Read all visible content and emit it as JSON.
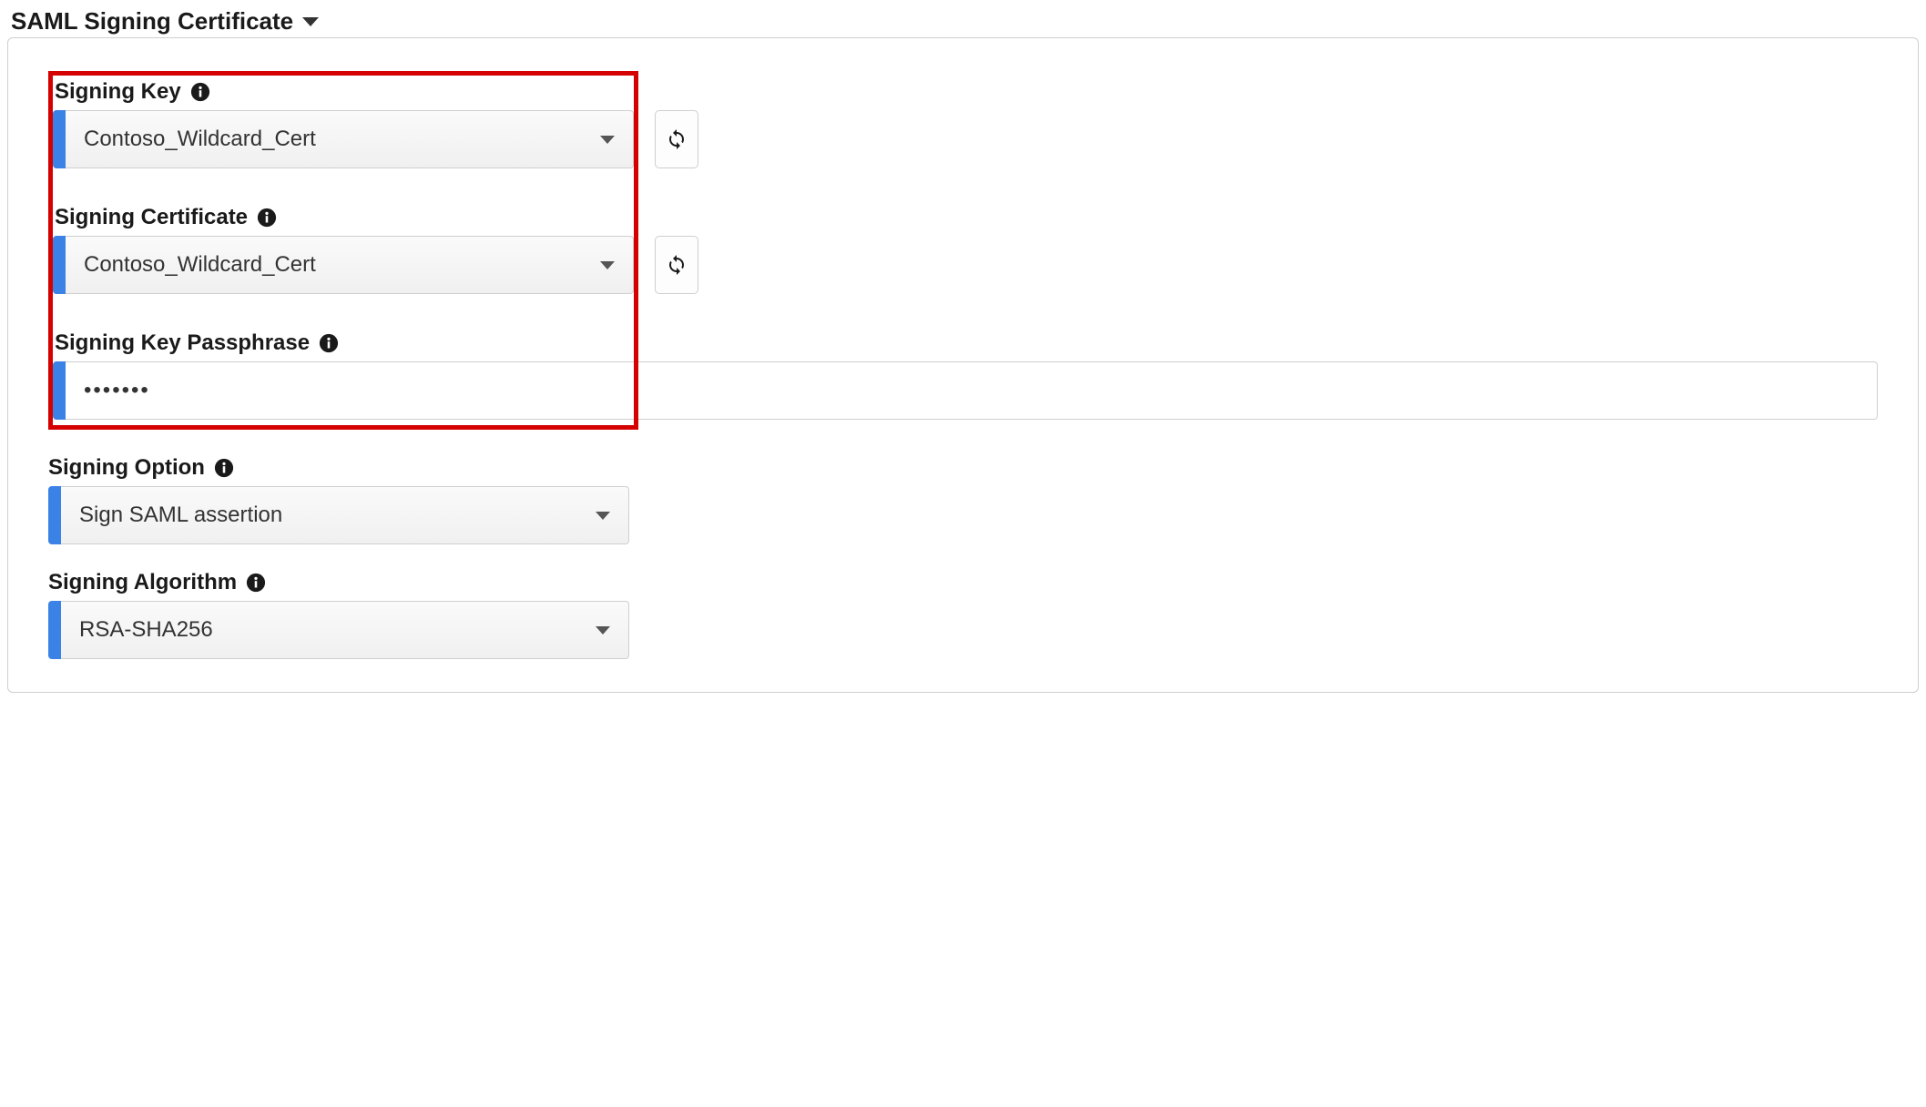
{
  "section": {
    "title": "SAML Signing Certificate"
  },
  "fields": {
    "signing_key": {
      "label": "Signing Key",
      "value": "Contoso_Wildcard_Cert"
    },
    "signing_certificate": {
      "label": "Signing Certificate",
      "value": "Contoso_Wildcard_Cert"
    },
    "signing_key_passphrase": {
      "label": "Signing Key Passphrase",
      "value": "•••••••"
    },
    "signing_option": {
      "label": "Signing Option",
      "value": "Sign SAML assertion"
    },
    "signing_algorithm": {
      "label": "Signing Algorithm",
      "value": "RSA-SHA256"
    }
  }
}
